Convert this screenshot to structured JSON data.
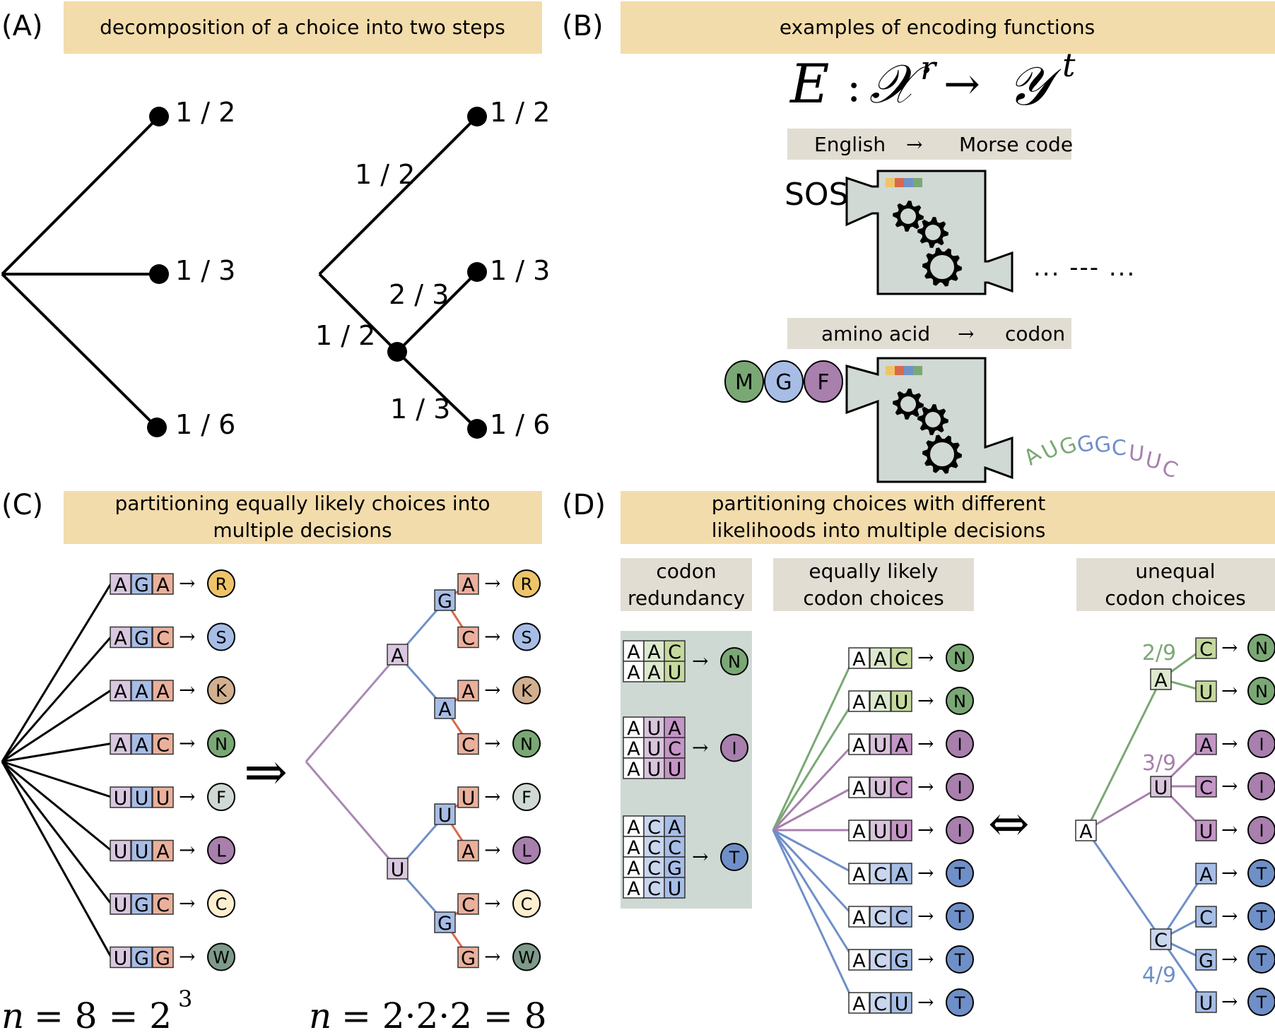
{
  "colors": {
    "banner": "#f3dcab",
    "subbanner": "#e2ddd2",
    "machine": "#d0d9d4",
    "redundancy_bg": "#cfd9d3",
    "nuc_pos1": "#d9c7df",
    "nuc_pos2": "#a7bde6",
    "nuc_pos3": "#eab09c",
    "edge_purple": "#a889b4",
    "edge_blue": "#7191c7",
    "edge_red": "#d86a4c",
    "green": "#7aa874",
    "purple": "#a87fad",
    "blue": "#6f8fc8",
    "green_light": "#dde9cf",
    "green_mid": "#c5d99e",
    "purple_light": "#d9c4dc",
    "purple_mid": "#c495c6",
    "blue_light": "#c9d6ee",
    "blue_mid": "#a6bde6",
    "strip": [
      "#eec46a",
      "#d86a4c",
      "#7191c7",
      "#7aa874"
    ]
  },
  "panelA": {
    "label": "(A)",
    "title": "decomposition of a choice into two steps",
    "left_tree": {
      "leaves": [
        "1 / 2",
        "1 / 3",
        "1 / 6"
      ]
    },
    "right_tree": {
      "leaves": [
        "1 / 2",
        "1 / 3",
        "1 / 6"
      ],
      "edge_labels": {
        "upper": "1 / 2",
        "lower": "1 / 2",
        "sub_upper": "2 / 3",
        "sub_lower": "1 / 3"
      }
    }
  },
  "panelB": {
    "label": "(B)",
    "title": "examples of encoding functions",
    "formula": {
      "E": "E",
      "colon": ":",
      "X": "𝒳",
      "r": "r",
      "arrow": "→",
      "Y": "𝒴",
      "t": "t"
    },
    "example1": {
      "from": "English",
      "arrow": "→",
      "to": "Morse code",
      "input": "SOS",
      "output": "... --- ..."
    },
    "example2": {
      "from": "amino acid",
      "arrow": "→",
      "to": "codon",
      "input_beads": [
        {
          "letter": "M",
          "color": "#7aa874"
        },
        {
          "letter": "G",
          "color": "#a7bde6"
        },
        {
          "letter": "F",
          "color": "#a87fad"
        }
      ],
      "output_letters": [
        {
          "ch": "A",
          "color": "#7aa874"
        },
        {
          "ch": "U",
          "color": "#7aa874"
        },
        {
          "ch": "G",
          "color": "#7aa874"
        },
        {
          "ch": "G",
          "color": "#6f8fc8"
        },
        {
          "ch": "G",
          "color": "#6f8fc8"
        },
        {
          "ch": "C",
          "color": "#6f8fc8"
        },
        {
          "ch": "U",
          "color": "#a87fad"
        },
        {
          "ch": "U",
          "color": "#a87fad"
        },
        {
          "ch": "C",
          "color": "#a87fad"
        }
      ]
    }
  },
  "panelC": {
    "label": "(C)",
    "title_line1": "partitioning equally likely choices into",
    "title_line2": "multiple decisions",
    "codons": [
      {
        "codon": "AGA",
        "aa": "R",
        "aa_color": "#eec46a"
      },
      {
        "codon": "AGC",
        "aa": "S",
        "aa_color": "#a7bde6"
      },
      {
        "codon": "AAA",
        "aa": "K",
        "aa_color": "#d2b08f"
      },
      {
        "codon": "AAC",
        "aa": "N",
        "aa_color": "#7aa874"
      },
      {
        "codon": "UUU",
        "aa": "F",
        "aa_color": "#d0d9d4"
      },
      {
        "codon": "UUA",
        "aa": "L",
        "aa_color": "#a87fad"
      },
      {
        "codon": "UGC",
        "aa": "C",
        "aa_color": "#fdefcf"
      },
      {
        "codon": "UGG",
        "aa": "W",
        "aa_color": "#7d9a8a"
      }
    ],
    "implies": "⇒",
    "tree": {
      "level1": [
        "A",
        "U"
      ],
      "level2": [
        "G",
        "A",
        "U",
        "G"
      ],
      "level3": [
        "A",
        "C",
        "A",
        "C",
        "U",
        "A",
        "C",
        "G"
      ]
    },
    "equation_left": {
      "n": "n",
      "eq": "= 8 = 2",
      "exp": "3"
    },
    "equation_right": {
      "n": "n",
      "eq": "= 2·2·2 = 8"
    }
  },
  "panelD": {
    "label": "(D)",
    "title_line1": "partitioning choices with different",
    "title_line2": "likelihoods into multiple decisions",
    "sub1": {
      "line1": "codon",
      "line2": "redundancy"
    },
    "sub2": {
      "line1": "equally likely",
      "line2": "codon choices"
    },
    "sub3": {
      "line1": "unequal",
      "line2": "codon choices"
    },
    "redundancy_groups": [
      {
        "codons": [
          "AAC",
          "AAU"
        ],
        "aa": "N",
        "family": "green"
      },
      {
        "codons": [
          "AUA",
          "AUC",
          "AUU"
        ],
        "aa": "I",
        "family": "purple"
      },
      {
        "codons": [
          "ACA",
          "ACC",
          "ACG",
          "ACU"
        ],
        "aa": "T",
        "family": "blue"
      }
    ],
    "equal_list": [
      {
        "codon": "AAC",
        "aa": "N",
        "family": "green"
      },
      {
        "codon": "AAU",
        "aa": "N",
        "family": "green"
      },
      {
        "codon": "AUA",
        "aa": "I",
        "family": "purple"
      },
      {
        "codon": "AUC",
        "aa": "I",
        "family": "purple"
      },
      {
        "codon": "AUU",
        "aa": "I",
        "family": "purple"
      },
      {
        "codon": "ACA",
        "aa": "T",
        "family": "blue"
      },
      {
        "codon": "ACC",
        "aa": "T",
        "family": "blue"
      },
      {
        "codon": "ACG",
        "aa": "T",
        "family": "blue"
      },
      {
        "codon": "ACU",
        "aa": "T",
        "family": "blue"
      }
    ],
    "iff": "⇔",
    "unequal_tree": {
      "root": "A",
      "branches": [
        {
          "node": "A",
          "prob": "2/9",
          "family": "green",
          "leaves": [
            "C",
            "U"
          ],
          "aa": "N"
        },
        {
          "node": "U",
          "prob": "3/9",
          "family": "purple",
          "leaves": [
            "A",
            "C",
            "U"
          ],
          "aa": "I"
        },
        {
          "node": "C",
          "prob": "4/9",
          "family": "blue",
          "leaves": [
            "A",
            "C",
            "G",
            "U"
          ],
          "aa": "T"
        }
      ]
    }
  }
}
